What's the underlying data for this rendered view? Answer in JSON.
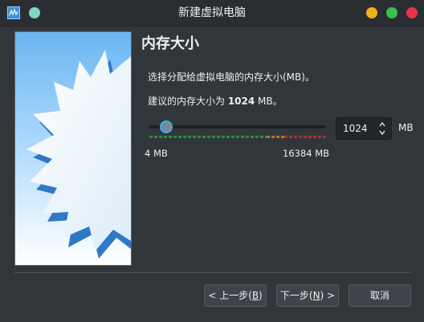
{
  "window": {
    "title": "新建虚拟电脑"
  },
  "page": {
    "heading": "内存大小",
    "description": "选择分配给虚拟电脑的内存大小(MB)。",
    "recommend_prefix": "建议的内存大小为 ",
    "recommend_value": "1024",
    "recommend_suffix": " MB。"
  },
  "memory": {
    "value": "1024",
    "unit": "MB",
    "min_label": "4 MB",
    "max_label": "16384 MB",
    "slider_min": 4,
    "slider_max": 16384,
    "slider_value": 1024
  },
  "buttons": {
    "back_prefix": "< 上一步(",
    "back_key": "B",
    "back_suffix": ")",
    "next_prefix": "下一步(",
    "next_key": "N",
    "next_suffix": ") >",
    "cancel": "取消"
  },
  "colors": {
    "accent": "#3daee9",
    "background": "#31363b",
    "minimize": "#f0b11a",
    "maximize": "#3bc14a",
    "close": "#e9334a"
  },
  "icons": {
    "app": "virtualbox-icon",
    "pin": "pin-icon",
    "spin_up": "chevron-up-icon",
    "spin_down": "chevron-down-icon"
  }
}
